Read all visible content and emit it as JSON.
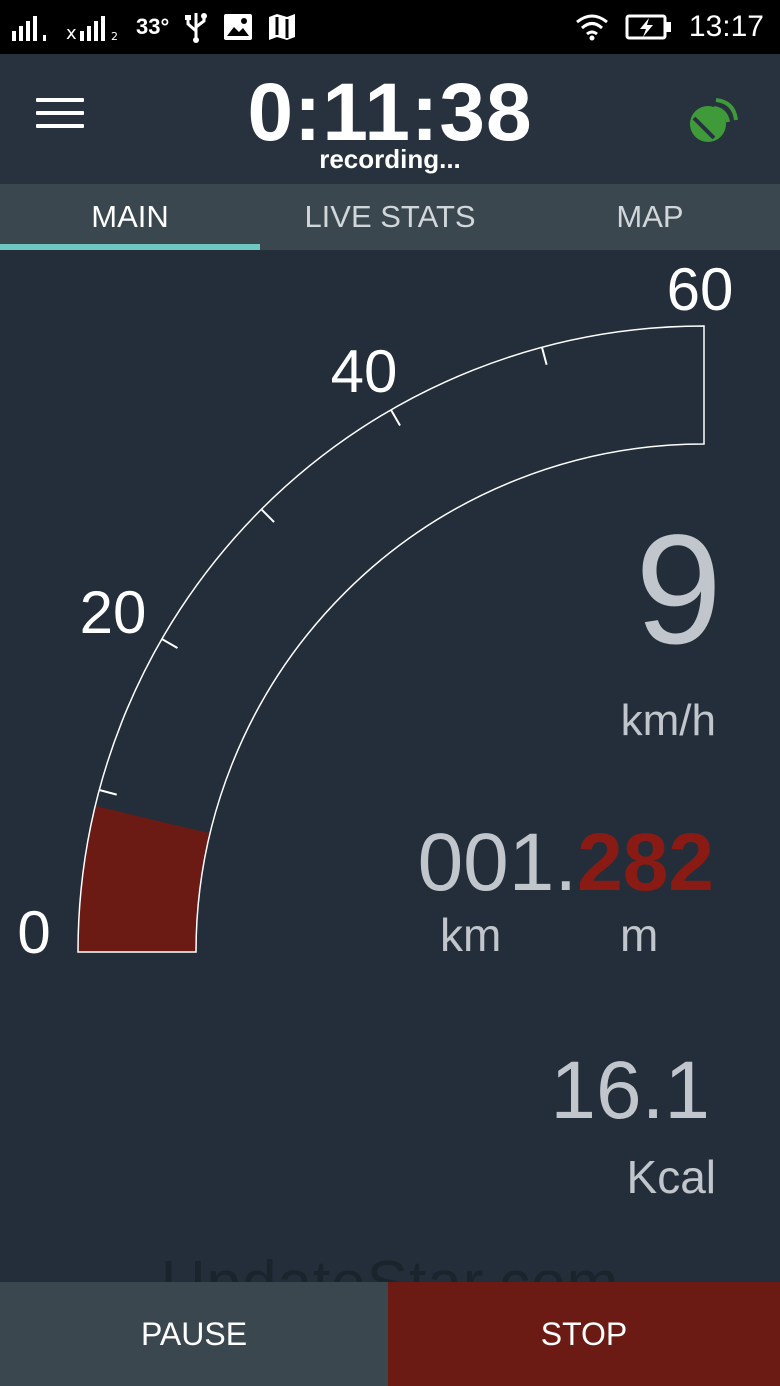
{
  "status_bar": {
    "temperature": "33°",
    "time": "13:17"
  },
  "header": {
    "elapsed_time": "0:11:38",
    "recording_status": "recording...",
    "gps_icon": "satellite-icon",
    "gps_color": "#3f9b3a"
  },
  "tabs": [
    {
      "label": "MAIN",
      "active": true
    },
    {
      "label": "LIVE STATS",
      "active": false
    },
    {
      "label": "MAP",
      "active": false
    }
  ],
  "gauge": {
    "min": 0,
    "max": 60,
    "tick_labels": [
      "0",
      "20",
      "40",
      "60"
    ],
    "current_speed": 9,
    "fill_color": "#6b1b13"
  },
  "speed": {
    "value": "9",
    "unit": "km/h"
  },
  "distance": {
    "km_part": "001.",
    "m_part": "282",
    "km_label": "km",
    "m_label": "m",
    "m_color": "#8a1b14"
  },
  "calories": {
    "value": "16.1",
    "unit": "Kcal"
  },
  "watermark": "UpdateStar.com",
  "buttons": {
    "pause": "PAUSE",
    "stop": "STOP"
  },
  "colors": {
    "background": "#232e3a",
    "tab_indicator": "#6fc7c0",
    "stop_button": "#6b1b13"
  }
}
